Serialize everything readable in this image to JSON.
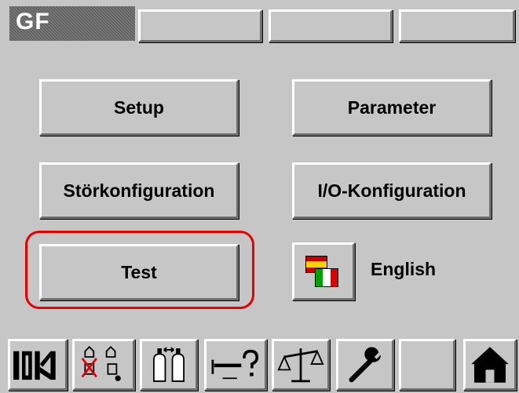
{
  "header": {
    "title": "GF"
  },
  "menu": {
    "setup": "Setup",
    "parameter": "Parameter",
    "fault_config": "Störkonfiguration",
    "io_config": "I/O-Konfiguration",
    "test": "Test",
    "language": "English"
  },
  "colors": {
    "background": "#c6c6c6",
    "highlight": "#e60000",
    "title_bar": "#5e5e5e"
  },
  "toolbar": {
    "icons": [
      "io-status-icon",
      "fault-status-icon",
      "gas-bottles-icon",
      "help-query-icon",
      "scale-icon",
      "wrench-icon",
      "home-icon"
    ]
  }
}
